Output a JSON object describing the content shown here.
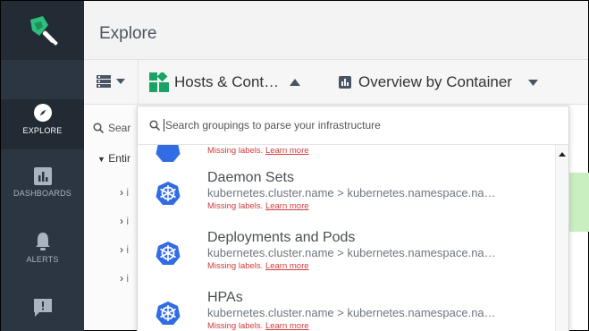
{
  "header": {
    "title": "Explore"
  },
  "sidebar": {
    "items": [
      {
        "label": "EXPLORE",
        "icon": "compass-icon"
      },
      {
        "label": "DASHBOARDS",
        "icon": "bar-chart-icon"
      },
      {
        "label": "ALERTS",
        "icon": "bell-icon"
      },
      {
        "label": "",
        "icon": "feedback-icon"
      }
    ]
  },
  "toolbar": {
    "hosts_label": "Hosts & Cont…",
    "overview_label": "Overview by Container"
  },
  "left_panel": {
    "search_placeholder": "Sear",
    "entire_label": "Entir",
    "row_label": "i"
  },
  "dropdown": {
    "search_placeholder": "Search groupings to parse your infrastructure",
    "missing_text": "Missing labels.",
    "learn_more": "Learn more",
    "items": [
      {
        "name": "",
        "path": ""
      },
      {
        "name": "Daemon Sets",
        "path": "kubernetes.cluster.name > kubernetes.namespace.na…"
      },
      {
        "name": "Deployments and Pods",
        "path": "kubernetes.cluster.name > kubernetes.namespace.na…"
      },
      {
        "name": "HPAs",
        "path": "kubernetes.cluster.name > kubernetes.namespace.na…"
      }
    ]
  },
  "colors": {
    "sidebar_bg": "#2c3642",
    "accent_green": "#1aa364",
    "k8s_blue": "#326ce5",
    "missing_red": "#d13b3b"
  }
}
